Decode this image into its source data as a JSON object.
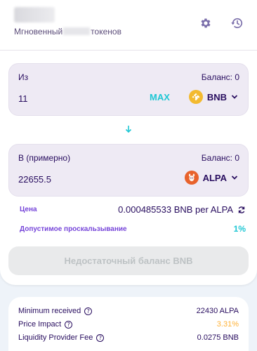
{
  "header": {
    "subtitle_prefix": "Мгновенный",
    "subtitle_suffix": "токенов",
    "settings_icon": "gear-icon",
    "history_icon": "history-icon"
  },
  "from_panel": {
    "label": "Из",
    "balance": "Баланс: 0",
    "amount": "11",
    "max_label": "MAX",
    "token": "BNB",
    "token_color": "#f3ba2f"
  },
  "swap_arrow_icon": "arrow-down-icon",
  "to_panel": {
    "label": "В (примерно)",
    "balance": "Баланс: 0",
    "amount": "22655.5",
    "token": "ALPA",
    "token_color": "#e8622b"
  },
  "price": {
    "label": "Цена",
    "value": "0.000485533 BNB per ALPA"
  },
  "slippage": {
    "label": "Допустимое проскальзывание",
    "value": "1%"
  },
  "action_button": {
    "label": "Недостаточный баланс BNB"
  },
  "details": {
    "minimum_received_label": "Minimum received",
    "minimum_received_value": "22430 ALPA",
    "price_impact_label": "Price Impact",
    "price_impact_value": "3.31%",
    "price_impact_color": "#ffb237",
    "lp_fee_label": "Liquidity Provider Fee",
    "lp_fee_value": "0.0275 BNB"
  },
  "colors": {
    "accent": "#1fc7d4",
    "text": "#280d5f",
    "secondary": "#7645d9",
    "panel_bg": "#eeeaf4",
    "page_bg": "#eef3f9"
  }
}
